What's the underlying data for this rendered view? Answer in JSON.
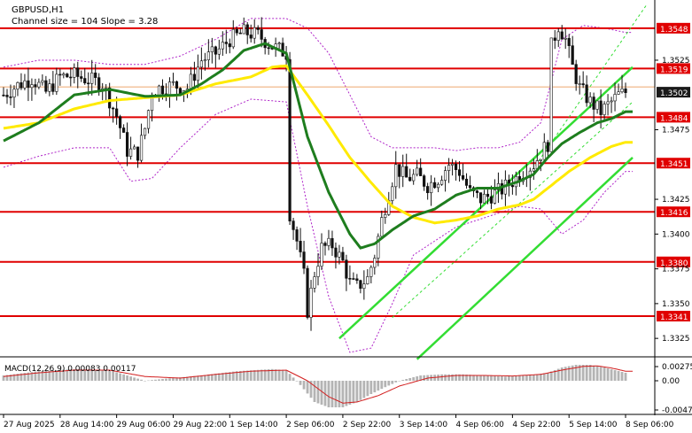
{
  "chart_data": {
    "type": "candlestick",
    "symbol": "GBPUSD,H1",
    "channel_info": "Channel size = 104 Slope = 3.28",
    "price_range": [
      1.3313,
      1.3567
    ],
    "price_ticks": [
      1.3525,
      1.3475,
      1.3425,
      1.34,
      1.3375,
      1.335,
      1.3325
    ],
    "price_tick_labels": [
      "1.3525",
      "1.3475",
      "1.3425",
      "1.3400",
      "1.3375",
      "1.3350",
      "1.3325"
    ],
    "levels": [
      {
        "value": 1.3548,
        "label": "1.3548"
      },
      {
        "value": 1.3519,
        "label": "1.3519"
      },
      {
        "value": 1.3484,
        "label": "1.3484"
      },
      {
        "value": 1.3451,
        "label": "1.3451"
      },
      {
        "value": 1.3416,
        "label": "1.3416"
      },
      {
        "value": 1.338,
        "label": "1.3380"
      },
      {
        "value": 1.3341,
        "label": "1.3341"
      }
    ],
    "current_price": {
      "value": 1.3502,
      "label": "1.3502"
    },
    "time_labels": [
      {
        "i": 0,
        "label": "27 Aug 2025"
      },
      {
        "i": 16,
        "label": "28 Aug 14:00"
      },
      {
        "i": 32,
        "label": "29 Aug 06:00"
      },
      {
        "i": 48,
        "label": "29 Aug 22:00"
      },
      {
        "i": 64,
        "label": "1 Sep 14:00"
      },
      {
        "i": 80,
        "label": "2 Sep 06:00"
      },
      {
        "i": 96,
        "label": "2 Sep 22:00"
      },
      {
        "i": 112,
        "label": "3 Sep 14:00"
      },
      {
        "i": 128,
        "label": "4 Sep 06:00"
      },
      {
        "i": 144,
        "label": "4 Sep 22:00"
      },
      {
        "i": 160,
        "label": "5 Sep 14:00"
      },
      {
        "i": 176,
        "label": "8 Sep 06:00"
      }
    ],
    "close_path": [
      [
        0,
        1.35
      ],
      [
        4,
        1.3507
      ],
      [
        8,
        1.3512
      ],
      [
        12,
        1.3502
      ],
      [
        16,
        1.3513
      ],
      [
        20,
        1.3514
      ],
      [
        24,
        1.3511
      ],
      [
        28,
        1.3508
      ],
      [
        32,
        1.3485
      ],
      [
        35,
        1.346
      ],
      [
        38,
        1.3458
      ],
      [
        40,
        1.3476
      ],
      [
        42,
        1.3502
      ],
      [
        44,
        1.3505
      ],
      [
        48,
        1.3507
      ],
      [
        52,
        1.3505
      ],
      [
        56,
        1.3525
      ],
      [
        60,
        1.353
      ],
      [
        64,
        1.354
      ],
      [
        68,
        1.3545
      ],
      [
        72,
        1.3543
      ],
      [
        76,
        1.3535
      ],
      [
        80,
        1.353
      ],
      [
        81,
        1.3415
      ],
      [
        83,
        1.3395
      ],
      [
        85,
        1.337
      ],
      [
        86,
        1.3345
      ],
      [
        88,
        1.3372
      ],
      [
        90,
        1.339
      ],
      [
        93,
        1.3392
      ],
      [
        96,
        1.338
      ],
      [
        98,
        1.3365
      ],
      [
        100,
        1.3362
      ],
      [
        103,
        1.3368
      ],
      [
        105,
        1.3385
      ],
      [
        107,
        1.341
      ],
      [
        109,
        1.343
      ],
      [
        111,
        1.3448
      ],
      [
        114,
        1.344
      ],
      [
        117,
        1.3442
      ],
      [
        120,
        1.3435
      ],
      [
        123,
        1.344
      ],
      [
        126,
        1.345
      ],
      [
        129,
        1.3445
      ],
      [
        132,
        1.343
      ],
      [
        135,
        1.3425
      ],
      [
        138,
        1.3428
      ],
      [
        141,
        1.3432
      ],
      [
        144,
        1.3438
      ],
      [
        147,
        1.3445
      ],
      [
        150,
        1.345
      ],
      [
        152,
        1.3458
      ],
      [
        154,
        1.3465
      ],
      [
        155,
        1.3535
      ],
      [
        157,
        1.355
      ],
      [
        159,
        1.354
      ],
      [
        161,
        1.352
      ],
      [
        163,
        1.3505
      ],
      [
        166,
        1.3495
      ],
      [
        169,
        1.3488
      ],
      [
        172,
        1.3495
      ],
      [
        174,
        1.35
      ],
      [
        176,
        1.3502
      ]
    ],
    "ma_green": [
      [
        0,
        1.3467
      ],
      [
        10,
        1.348
      ],
      [
        20,
        1.35
      ],
      [
        30,
        1.3504
      ],
      [
        40,
        1.3499
      ],
      [
        50,
        1.35
      ],
      [
        56,
        1.3508
      ],
      [
        62,
        1.3518
      ],
      [
        68,
        1.3532
      ],
      [
        74,
        1.3537
      ],
      [
        80,
        1.353
      ],
      [
        86,
        1.347
      ],
      [
        92,
        1.343
      ],
      [
        98,
        1.34
      ],
      [
        101,
        1.339
      ],
      [
        105,
        1.3393
      ],
      [
        110,
        1.3403
      ],
      [
        116,
        1.3413
      ],
      [
        122,
        1.3418
      ],
      [
        128,
        1.3428
      ],
      [
        134,
        1.3433
      ],
      [
        140,
        1.3433
      ],
      [
        146,
        1.3438
      ],
      [
        150,
        1.3443
      ],
      [
        154,
        1.3455
      ],
      [
        158,
        1.3465
      ],
      [
        163,
        1.3473
      ],
      [
        168,
        1.348
      ],
      [
        172,
        1.3483
      ],
      [
        176,
        1.3488
      ]
    ],
    "ma_yellow": [
      [
        0,
        1.3476
      ],
      [
        10,
        1.348
      ],
      [
        20,
        1.349
      ],
      [
        30,
        1.3496
      ],
      [
        40,
        1.3498
      ],
      [
        50,
        1.35
      ],
      [
        60,
        1.3508
      ],
      [
        70,
        1.3513
      ],
      [
        76,
        1.352
      ],
      [
        80,
        1.3521
      ],
      [
        86,
        1.35
      ],
      [
        92,
        1.3478
      ],
      [
        98,
        1.3455
      ],
      [
        104,
        1.3437
      ],
      [
        110,
        1.342
      ],
      [
        116,
        1.3412
      ],
      [
        122,
        1.3408
      ],
      [
        128,
        1.341
      ],
      [
        134,
        1.3413
      ],
      [
        140,
        1.3418
      ],
      [
        146,
        1.3421
      ],
      [
        150,
        1.3425
      ],
      [
        154,
        1.3433
      ],
      [
        160,
        1.3445
      ],
      [
        166,
        1.3455
      ],
      [
        172,
        1.3463
      ],
      [
        176,
        1.3466
      ]
    ],
    "bb_upper": [
      [
        0,
        1.352
      ],
      [
        10,
        1.3525
      ],
      [
        20,
        1.3525
      ],
      [
        30,
        1.3522
      ],
      [
        40,
        1.3522
      ],
      [
        50,
        1.3528
      ],
      [
        60,
        1.354
      ],
      [
        70,
        1.3555
      ],
      [
        80,
        1.3555
      ],
      [
        86,
        1.3548
      ],
      [
        92,
        1.353
      ],
      [
        98,
        1.35
      ],
      [
        104,
        1.347
      ],
      [
        110,
        1.3462
      ],
      [
        116,
        1.3462
      ],
      [
        122,
        1.3462
      ],
      [
        128,
        1.346
      ],
      [
        134,
        1.3462
      ],
      [
        140,
        1.3462
      ],
      [
        146,
        1.3466
      ],
      [
        152,
        1.348
      ],
      [
        158,
        1.354
      ],
      [
        164,
        1.355
      ],
      [
        170,
        1.3548
      ],
      [
        176,
        1.3545
      ]
    ],
    "bb_lower": [
      [
        0,
        1.3448
      ],
      [
        10,
        1.3456
      ],
      [
        20,
        1.3462
      ],
      [
        30,
        1.3462
      ],
      [
        36,
        1.3438
      ],
      [
        42,
        1.344
      ],
      [
        50,
        1.3462
      ],
      [
        60,
        1.3486
      ],
      [
        70,
        1.3497
      ],
      [
        80,
        1.3495
      ],
      [
        86,
        1.342
      ],
      [
        92,
        1.3355
      ],
      [
        98,
        1.3315
      ],
      [
        104,
        1.3318
      ],
      [
        110,
        1.335
      ],
      [
        116,
        1.3385
      ],
      [
        122,
        1.3395
      ],
      [
        128,
        1.3405
      ],
      [
        134,
        1.341
      ],
      [
        140,
        1.3415
      ],
      [
        146,
        1.342
      ],
      [
        152,
        1.3418
      ],
      [
        158,
        1.34
      ],
      [
        164,
        1.341
      ],
      [
        170,
        1.343
      ],
      [
        176,
        1.3445
      ]
    ],
    "channel_lines": [
      {
        "role": "support",
        "from": [
          95,
          1.3325
        ],
        "to": [
          178,
          1.352
        ]
      },
      {
        "role": "support",
        "from": [
          117,
          1.331
        ],
        "to": [
          178,
          1.3455
        ]
      },
      {
        "role": "dashed",
        "from": [
          110,
          1.334
        ],
        "to": [
          178,
          1.3495
        ]
      },
      {
        "role": "dashed",
        "from": [
          148,
          1.344
        ],
        "to": [
          182,
          1.3565
        ]
      }
    ],
    "macd": {
      "label": "MACD(12,26,9) 0.00083 0.00117",
      "range": [
        -0.0006,
        0.0004
      ],
      "ticks": [
        0.00275,
        0.0,
        -0.00474
      ],
      "tick_labels": [
        "0.00275",
        "0.00",
        "-0.00474"
      ],
      "hist": [
        [
          0,
          0.0001
        ],
        [
          10,
          0.00018
        ],
        [
          20,
          0.00022
        ],
        [
          30,
          0.0002
        ],
        [
          36,
          8e-05
        ],
        [
          40,
          0.0
        ],
        [
          46,
          4e-05
        ],
        [
          56,
          0.0001
        ],
        [
          66,
          0.00018
        ],
        [
          76,
          0.00022
        ],
        [
          80,
          0.0002
        ],
        [
          84,
          -8e-05
        ],
        [
          88,
          -0.0004
        ],
        [
          92,
          -0.0005
        ],
        [
          96,
          -0.0005
        ],
        [
          100,
          -0.0004
        ],
        [
          104,
          -0.00025
        ],
        [
          108,
          -0.00012
        ],
        [
          112,
          0.0
        ],
        [
          118,
          0.0001
        ],
        [
          124,
          0.00012
        ],
        [
          130,
          0.00012
        ],
        [
          136,
          0.0001
        ],
        [
          142,
          8e-05
        ],
        [
          148,
          0.0001
        ],
        [
          154,
          0.00015
        ],
        [
          158,
          0.00025
        ],
        [
          162,
          0.0003
        ],
        [
          166,
          0.0003
        ],
        [
          170,
          0.00025
        ],
        [
          176,
          0.00015
        ]
      ],
      "signal": [
        [
          0,
          8e-05
        ],
        [
          10,
          0.00015
        ],
        [
          20,
          0.0002
        ],
        [
          30,
          0.0002
        ],
        [
          40,
          8e-05
        ],
        [
          50,
          5e-05
        ],
        [
          60,
          0.00012
        ],
        [
          70,
          0.00018
        ],
        [
          80,
          0.0002
        ],
        [
          86,
          0.0
        ],
        [
          92,
          -0.0003
        ],
        [
          96,
          -0.00042
        ],
        [
          100,
          -0.0004
        ],
        [
          106,
          -0.00028
        ],
        [
          112,
          -0.0001
        ],
        [
          120,
          5e-05
        ],
        [
          128,
          0.0001
        ],
        [
          136,
          0.0001
        ],
        [
          144,
          9e-05
        ],
        [
          152,
          0.00012
        ],
        [
          158,
          0.0002
        ],
        [
          164,
          0.00027
        ],
        [
          168,
          0.00028
        ],
        [
          172,
          0.00024
        ],
        [
          176,
          0.00018
        ]
      ]
    },
    "colors": {
      "level": "#e00000",
      "level_label_bg": "#e00000",
      "price_tag_bg": "#1a1a1a",
      "candle": "#111111",
      "ma_green": "#1e7d1e",
      "ma_yellow": "#ffea00",
      "bands": "#b026c9",
      "channel": "#33dd33",
      "macd_hist": "#b4b4b4",
      "macd_signal": "#d21e1e",
      "grid_text": "#000000"
    }
  }
}
